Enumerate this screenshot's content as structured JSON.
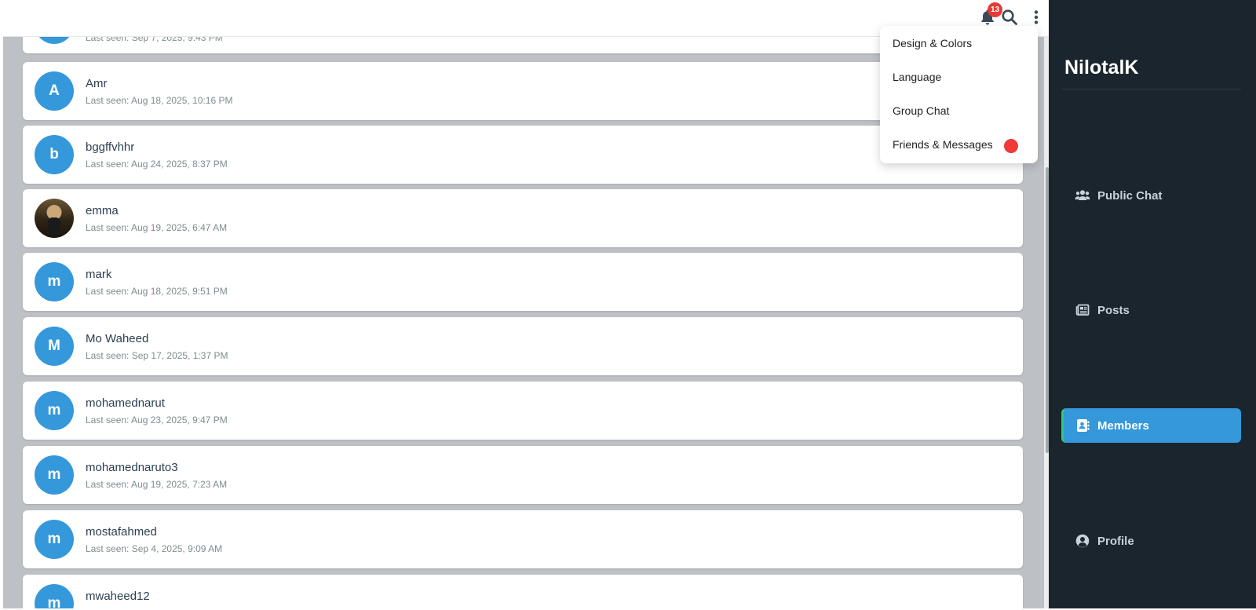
{
  "header": {
    "notification_count": "13",
    "icons": [
      "bell-icon",
      "search-icon",
      "more-vertical-icon"
    ]
  },
  "menu": {
    "items": [
      {
        "label": "Design & Colors"
      },
      {
        "label": "Language"
      },
      {
        "label": "Group Chat"
      },
      {
        "label": "Friends & Messages",
        "has_alert_dot": true
      }
    ],
    "alert_color": "#f03a3a"
  },
  "members": [
    {
      "name": "",
      "last_seen": "Last seen: Sep 7, 2025, 9:43 PM",
      "initial": ""
    },
    {
      "name": "Amr",
      "last_seen": "Last seen: Aug 18, 2025, 10:16 PM",
      "initial": "A"
    },
    {
      "name": "bggffvhhr",
      "last_seen": "Last seen: Aug 24, 2025, 8:37 PM",
      "initial": "b"
    },
    {
      "name": "emma",
      "last_seen": "Last seen: Aug 19, 2025, 6:47 AM",
      "initial": "",
      "photo": true
    },
    {
      "name": "mark",
      "last_seen": "Last seen: Aug 18, 2025, 9:51 PM",
      "initial": "m"
    },
    {
      "name": "Mo Waheed",
      "last_seen": "Last seen: Sep 17, 2025, 1:37 PM",
      "initial": "M"
    },
    {
      "name": "mohamednarut",
      "last_seen": "Last seen: Aug 23, 2025, 9:47 PM",
      "initial": "m"
    },
    {
      "name": "mohamednaruto3",
      "last_seen": "Last seen: Aug 19, 2025, 7:23 AM",
      "initial": "m"
    },
    {
      "name": "mostafahmed",
      "last_seen": "Last seen: Sep 4, 2025, 9:09 AM",
      "initial": "m"
    },
    {
      "name": "mwaheed12",
      "last_seen": "",
      "initial": "m"
    }
  ],
  "sidebar": {
    "brand": "NilotalK",
    "items": [
      {
        "label": "Public Chat",
        "icon": "users-icon"
      },
      {
        "label": "Posts",
        "icon": "newspaper-icon"
      },
      {
        "label": "Members",
        "icon": "address-book-icon",
        "active": true
      },
      {
        "label": "Profile",
        "icon": "user-circle-icon"
      }
    ]
  },
  "colors": {
    "accent": "#3498db",
    "sidebar_bg": "#1b252d",
    "active_indicator": "#2ecc71",
    "badge": "#e53935"
  }
}
